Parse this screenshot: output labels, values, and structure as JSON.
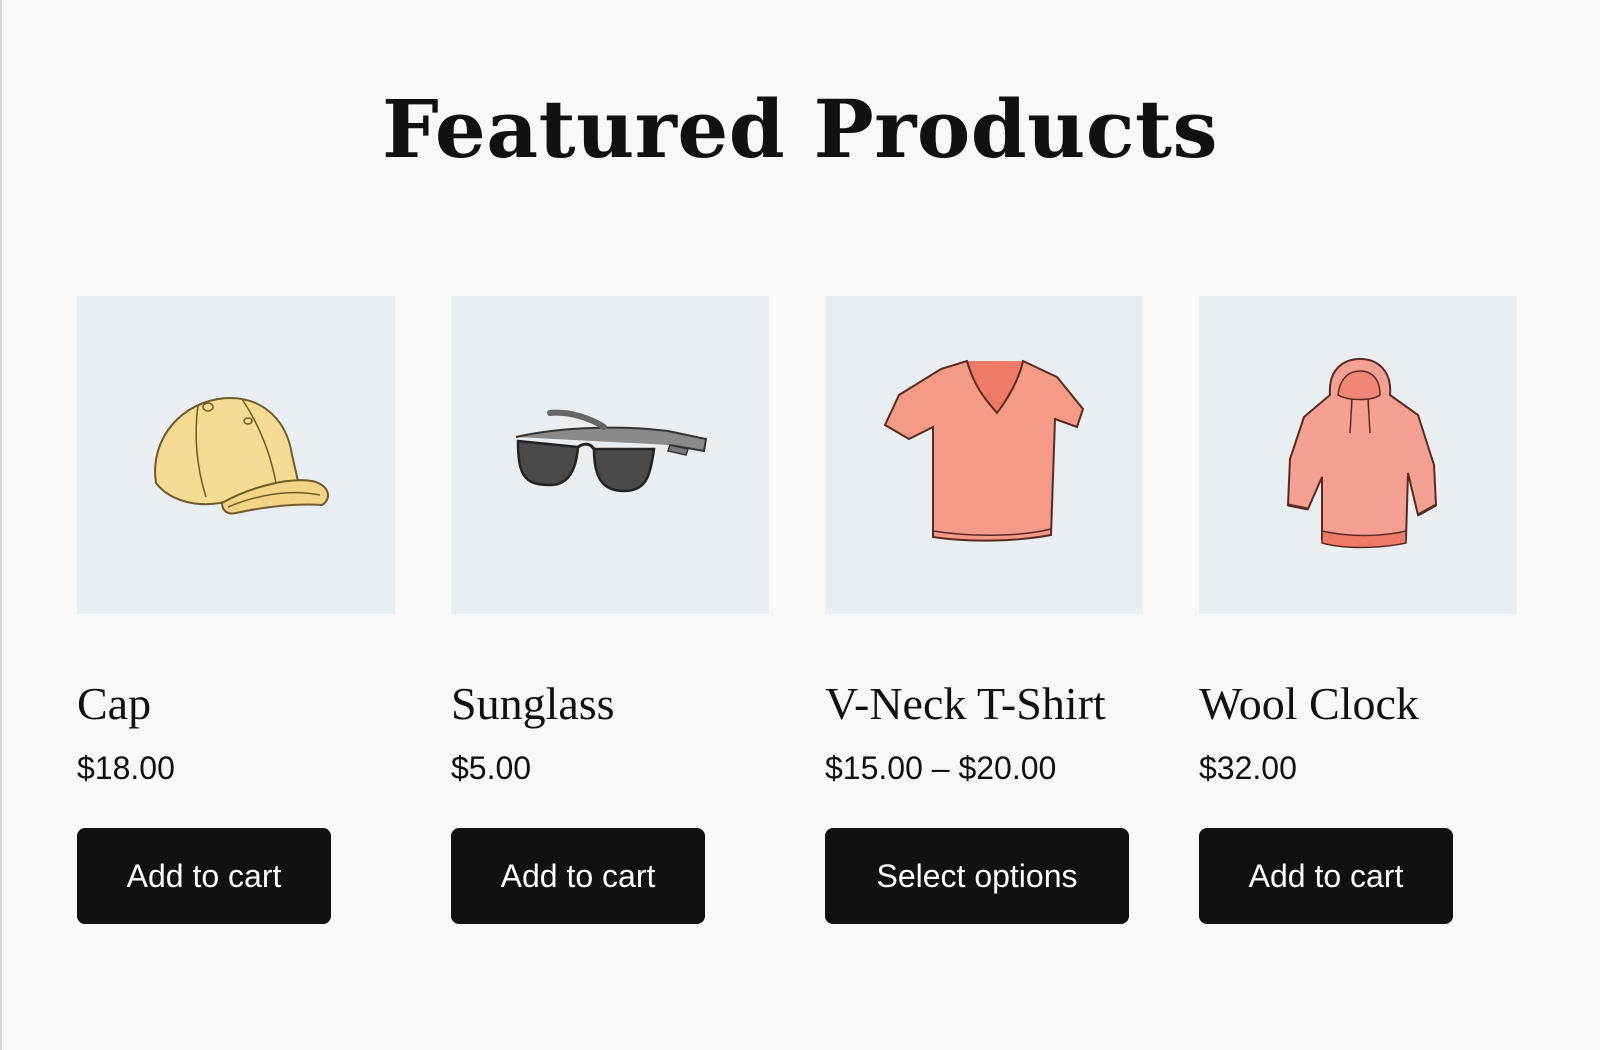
{
  "section": {
    "title": "Featured Products"
  },
  "products": [
    {
      "name": "Cap",
      "price": "$18.00",
      "button_label": "Add to cart",
      "image_icon": "cap-icon",
      "color": "#f4d98c"
    },
    {
      "name": "Sunglass",
      "price": "$5.00",
      "button_label": "Add to cart",
      "image_icon": "sunglasses-icon",
      "color": "#5c5c5c"
    },
    {
      "name": "V-Neck T-Shirt",
      "price": "$15.00 – $20.00",
      "button_label": "Select options",
      "image_icon": "tshirt-icon",
      "color": "#f48f7b"
    },
    {
      "name": "Wool Clock",
      "price": "$32.00",
      "button_label": "Add to cart",
      "image_icon": "hoodie-icon",
      "color": "#f3988a"
    }
  ],
  "colors": {
    "page_background": "#f8f8f8",
    "image_background": "#e9eef3",
    "button_background": "#111111",
    "button_text": "#ffffff"
  }
}
